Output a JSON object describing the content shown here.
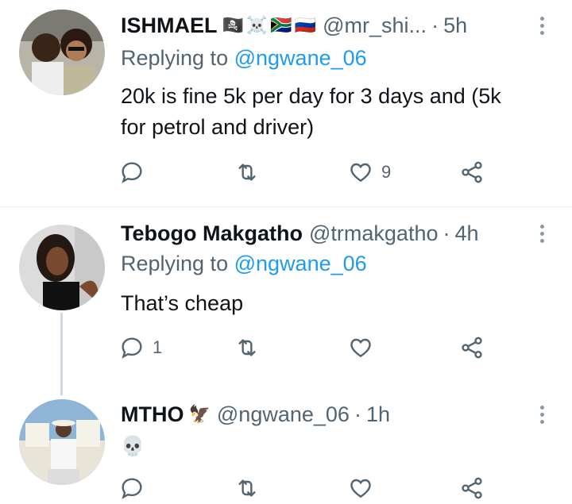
{
  "tweets": [
    {
      "name": "ISHMAEL",
      "name_emojis": [
        "🏴‍☠️",
        "☠️",
        "🇿🇦",
        "🇷🇺"
      ],
      "handle": "@mr_shi...",
      "separator": "·",
      "time": "5h",
      "replying_prefix": "Replying to",
      "replying_to": "@ngwane_06",
      "text_lines": [
        "20k is fine 5k per day for 3 days and (5k",
        "for petrol and driver)"
      ],
      "reply_count": "",
      "retweet_count": "",
      "like_count": "9"
    },
    {
      "name": "Tebogo Makgatho",
      "handle": "@trmakgatho",
      "separator": "·",
      "time": "4h",
      "replying_prefix": "Replying to",
      "replying_to": "@ngwane_06",
      "text": "That’s cheap",
      "reply_count": "1",
      "retweet_count": "",
      "like_count": ""
    },
    {
      "name": "MTHO",
      "name_emoji": "🦅",
      "handle": "@ngwane_06",
      "separator": "·",
      "time": "1h",
      "text": "💀"
    }
  ],
  "colors": {
    "text_primary": "#0f1419",
    "text_secondary": "#536471",
    "link": "#1d9bf0",
    "divider": "#e6ecf0",
    "thread_line": "#cfd9de"
  },
  "icons": [
    "reply-icon",
    "retweet-icon",
    "like-icon",
    "share-icon",
    "more-icon"
  ]
}
